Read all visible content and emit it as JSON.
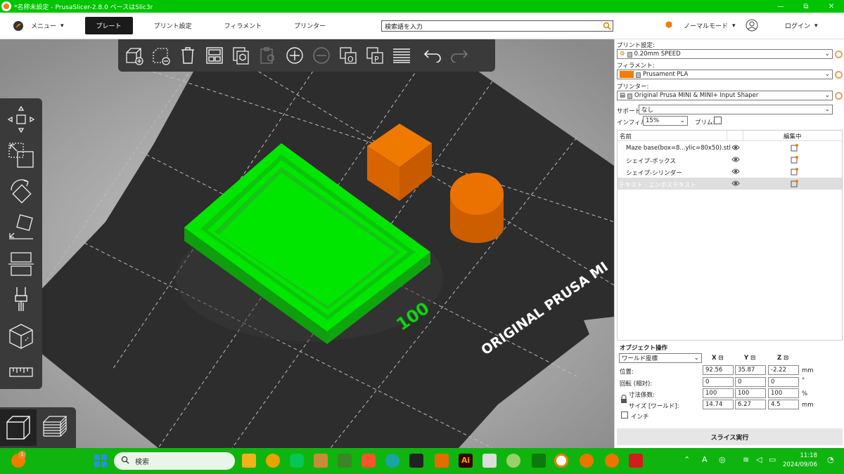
{
  "window": {
    "title": "*名称未設定 - PrusaSlicer-2.8.0 ベースはSlic3r",
    "minimize": "—",
    "maximize": "⧉",
    "close": "✕"
  },
  "menubar": {
    "menu_label": "メニュー",
    "tabs": [
      {
        "label": "プレート",
        "active": true
      },
      {
        "label": "プリント設定"
      },
      {
        "label": "フィラメント"
      },
      {
        "label": "プリンター"
      }
    ],
    "search_placeholder": "検索語を入力",
    "mode_label": "ノーマルモード",
    "login_label": "ログイン"
  },
  "sidebar": {
    "print_settings_label": "プリント設定:",
    "print_settings_value": "0.20mm SPEED",
    "filament_label": "フィラメント:",
    "filament_value": "Prusament PLA",
    "filament_color": "#f07d00",
    "printer_label": "プリンター:",
    "printer_value": "Original Prusa MINI & MINI+ Input Shaper",
    "support_label": "サポート:",
    "support_value": "なし",
    "infill_label": "インフィル:",
    "infill_value": "15%",
    "brim_label": "ブリム:",
    "brim_checked": false,
    "object_list": {
      "col_name": "名前",
      "col_edit": "編集中",
      "rows": [
        {
          "name": "Maze base(box=8...ylic=80x50).stl",
          "selected": false
        },
        {
          "name": "シェイプ-ボックス",
          "selected": false
        },
        {
          "name": "シェイプ-シリンダー",
          "selected": false
        },
        {
          "name": "テキスト - エンボステキスト",
          "selected": true
        }
      ]
    },
    "object_ops": {
      "title": "オブジェクト操作",
      "coord_system": "ワールド座標",
      "axis_x": "X",
      "axis_y": "Y",
      "axis_z": "Z",
      "position_label": "位置:",
      "position": [
        "92.56",
        "35.87",
        "-2.22"
      ],
      "position_unit": "mm",
      "rotation_label": "回転 (相対):",
      "rotation": [
        "0",
        "0",
        "0"
      ],
      "rotation_unit": "°",
      "scale_label": "寸法係数:",
      "scale": [
        "100",
        "100",
        "100"
      ],
      "scale_unit": "%",
      "size_label": "サイズ [ワールド]:",
      "size": [
        "14.74",
        "6.27",
        "4.5"
      ],
      "size_unit": "mm",
      "inch_label": "インチ"
    },
    "slice_button": "スライス実行"
  },
  "viewport": {
    "bed_text": "ORIGINAL PRUSA MI",
    "emboss_text": "100",
    "colors": {
      "base": "#00e600",
      "orange": "#e06a00",
      "bed": "#2d2d2d"
    }
  },
  "taskbar": {
    "search_label": "検索",
    "time": "11:18",
    "date": "2024/09/06",
    "notification_count": "1",
    "ime_label": "A"
  }
}
